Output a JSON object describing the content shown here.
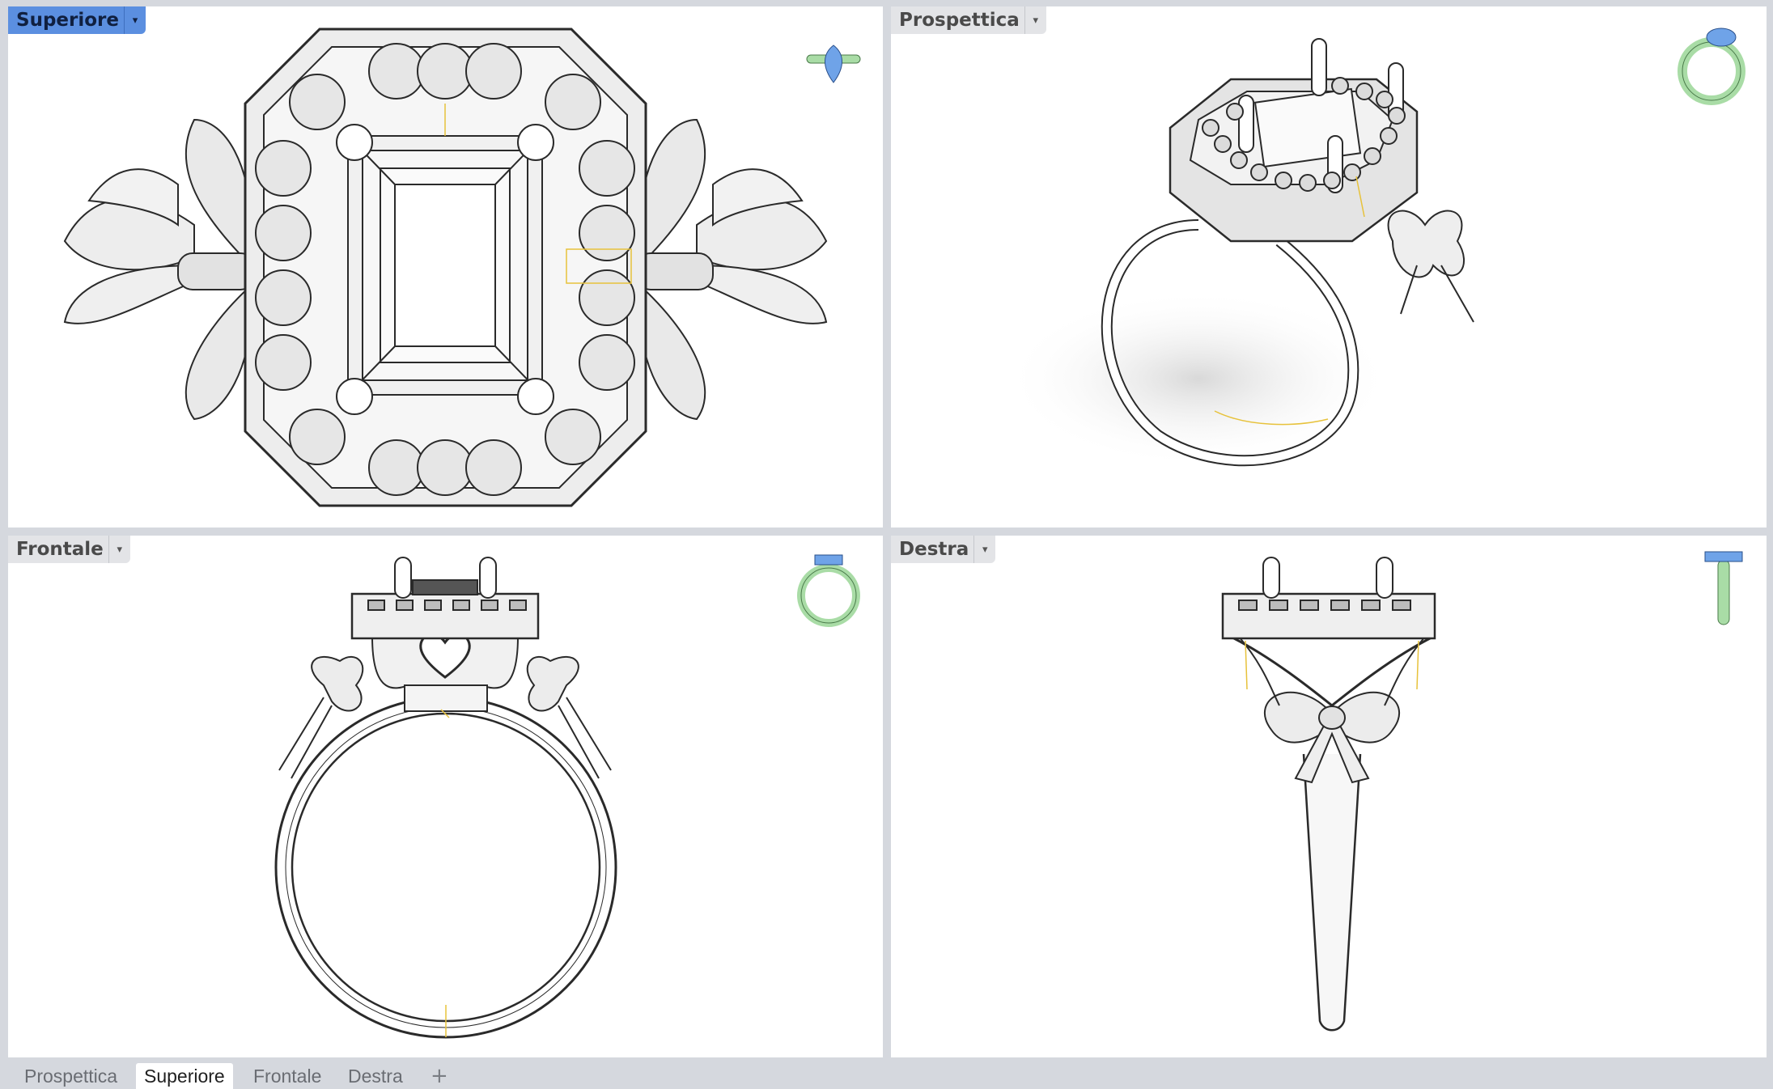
{
  "viewports": {
    "top": {
      "label": "Superiore",
      "active": true
    },
    "persp": {
      "label": "Prospettica",
      "active": false
    },
    "front": {
      "label": "Frontale",
      "active": false
    },
    "right": {
      "label": "Destra",
      "active": false
    }
  },
  "icons": {
    "dropdown": "▾",
    "add_tab": "+"
  },
  "tabs": [
    {
      "label": "Prospettica",
      "active": false
    },
    {
      "label": "Superiore",
      "active": true
    },
    {
      "label": "Frontale",
      "active": false
    },
    {
      "label": "Destra",
      "active": false
    }
  ],
  "colors": {
    "active_label": "#5b8fe0",
    "gizmo_green": "#a9dca6",
    "gizmo_blue": "#6fa3e8",
    "construction_line": "#e7c23b"
  }
}
